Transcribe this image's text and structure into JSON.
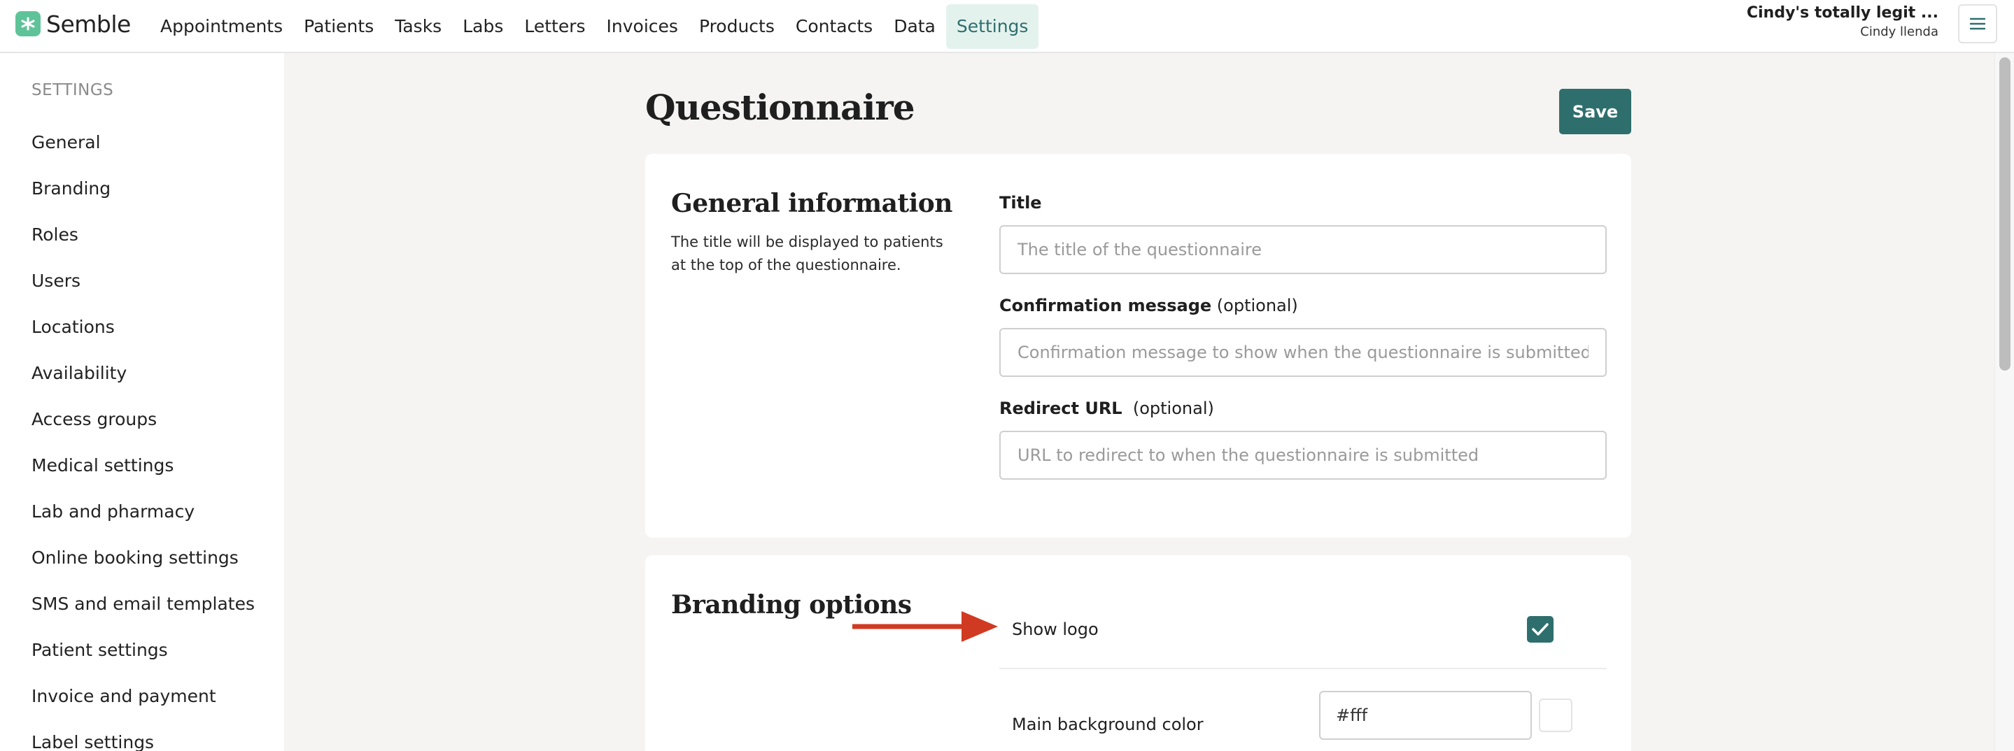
{
  "brand": {
    "name": "Semble",
    "accent": "#2e6f6d",
    "logo_color": "#5fc39a"
  },
  "nav": {
    "items": [
      {
        "label": "Appointments"
      },
      {
        "label": "Patients"
      },
      {
        "label": "Tasks"
      },
      {
        "label": "Labs"
      },
      {
        "label": "Letters"
      },
      {
        "label": "Invoices"
      },
      {
        "label": "Products"
      },
      {
        "label": "Contacts"
      },
      {
        "label": "Data"
      },
      {
        "label": "Settings",
        "active": true
      }
    ]
  },
  "account": {
    "practice": "Cindy's totally legit ...",
    "user": "Cindy llenda"
  },
  "sidebar": {
    "heading": "SETTINGS",
    "items": [
      {
        "label": "General"
      },
      {
        "label": "Branding"
      },
      {
        "label": "Roles"
      },
      {
        "label": "Users"
      },
      {
        "label": "Locations"
      },
      {
        "label": "Availability"
      },
      {
        "label": "Access groups"
      },
      {
        "label": "Medical settings"
      },
      {
        "label": "Lab and pharmacy"
      },
      {
        "label": "Online booking settings"
      },
      {
        "label": "SMS and email templates"
      },
      {
        "label": "Patient settings"
      },
      {
        "label": "Invoice and payment"
      },
      {
        "label": "Label settings"
      }
    ]
  },
  "page": {
    "title": "Questionnaire",
    "save_label": "Save"
  },
  "general_info": {
    "title": "General information",
    "description": "The title will be displayed to patients at the top of the questionnaire.",
    "fields": {
      "title": {
        "label": "Title",
        "placeholder": "The title of the questionnaire",
        "value": ""
      },
      "confirmation": {
        "label": "Confirmation message",
        "optional": "(optional)",
        "placeholder": "Confirmation message to show when the questionnaire is submitted",
        "value": ""
      },
      "redirect": {
        "label": "Redirect URL",
        "optional": "(optional)",
        "placeholder": "URL to redirect to when the questionnaire is submitted",
        "value": ""
      }
    }
  },
  "branding": {
    "title": "Branding options",
    "show_logo": {
      "label": "Show logo",
      "checked": true
    },
    "main_bg": {
      "label": "Main background color",
      "value": "#fff"
    }
  },
  "annotation": {
    "arrow_color": "#d03a22"
  }
}
